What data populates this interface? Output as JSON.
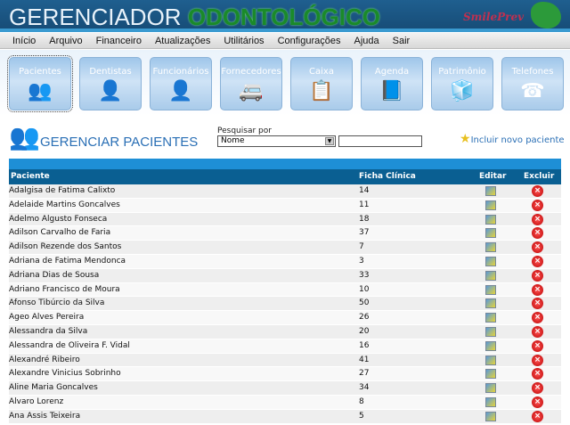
{
  "header": {
    "title_part1": "GERENCIADOR",
    "title_part2": "ODONTOLÓGICO",
    "logo_text": "SmilePrev"
  },
  "menu": [
    "Início",
    "Arquivo",
    "Financeiro",
    "Atualizações",
    "Utilitários",
    "Configurações",
    "Ajuda",
    "Sair"
  ],
  "tiles": [
    {
      "label": "Pacientes",
      "icon": "👥"
    },
    {
      "label": "Dentistas",
      "icon": "👤"
    },
    {
      "label": "Funcionários",
      "icon": "👤"
    },
    {
      "label": "Fornecedores",
      "icon": "🚐"
    },
    {
      "label": "Caixa",
      "icon": "📋"
    },
    {
      "label": "Agenda",
      "icon": "📘"
    },
    {
      "label": "Patrimônio",
      "icon": "🧊"
    },
    {
      "label": "Telefones",
      "icon": "☎"
    }
  ],
  "page": {
    "title": "GERENCIAR PACIENTES",
    "search_label": "Pesquisar por",
    "search_select": "Nome",
    "search_value": "",
    "add_label": "Incluir novo paciente"
  },
  "table": {
    "headers": [
      "Paciente",
      "Ficha Clínica",
      "Editar",
      "Excluir"
    ],
    "rows": [
      [
        "Adalgisa de Fatima Calixto",
        "14"
      ],
      [
        "Adelaide Martins Goncalves",
        "11"
      ],
      [
        "Adelmo Algusto Fonseca",
        "18"
      ],
      [
        "Adilson Carvalho de Faria",
        "37"
      ],
      [
        "Adilson Rezende dos Santos",
        "7"
      ],
      [
        "Adriana de Fatima Mendonca",
        "3"
      ],
      [
        "Adriana Dias de Sousa",
        "33"
      ],
      [
        "Adriano Francisco de Moura",
        "10"
      ],
      [
        "Afonso Tibúrcio da Silva",
        "50"
      ],
      [
        "Ageo Alves Pereira",
        "26"
      ],
      [
        "Alessandra da Silva",
        "20"
      ],
      [
        "Alessandra de Oliveira F. Vidal",
        "16"
      ],
      [
        "Alexandré Ribeiro",
        "41"
      ],
      [
        "Alexandre Vinicius Sobrinho",
        "27"
      ],
      [
        "Aline Maria Goncalves",
        "34"
      ],
      [
        "Alvaro Lorenz",
        "8"
      ],
      [
        "Ana Assis Teixeira",
        "5"
      ]
    ]
  }
}
